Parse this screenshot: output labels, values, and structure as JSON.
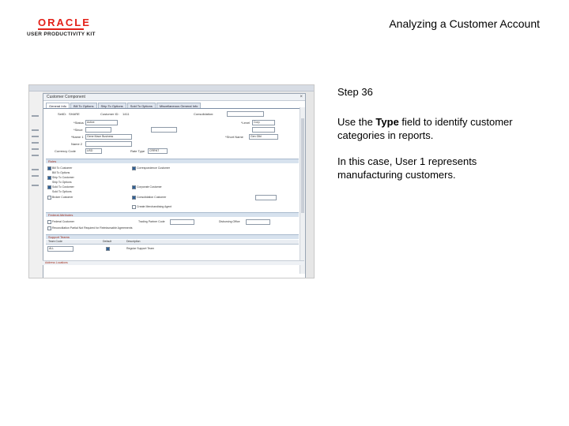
{
  "header": {
    "logo_brand": "ORACLE",
    "logo_sub": "USER PRODUCTIVITY KIT",
    "title": "Analyzing a Customer Account"
  },
  "screenshot": {
    "dialog_title": "Customer Component",
    "tabs": [
      "General Info",
      "Bill To Options",
      "Ship To Options",
      "Sold To Options",
      "Miscellaneous General Info"
    ],
    "fields": {
      "setid_label": "SetID:",
      "setid_value": "SHARE",
      "customer_id_label": "Customer ID:",
      "customer_id_value": "1411",
      "consolidation_label": "Consolidation:",
      "status_label": "*Status",
      "status_value": "Active",
      "since_label": "*Since",
      "level_label": "*Level",
      "level_value": "Corp",
      "name1_label": "*Name 1",
      "name1_value": "Gene Mace Business",
      "name2_label": "Name 2",
      "currency_label": "Currency Code",
      "currency_value": "USD",
      "rate_type_label": "Rate Type",
      "rate_type_value": "CRRNT",
      "short_name_label": "*Short Name",
      "short_name_value": "Gen Glbl"
    },
    "roles_section": "Roles",
    "roles": [
      {
        "label": "Bill To Customer",
        "checked": true
      },
      {
        "label": "Bill To Options",
        "checked": false
      },
      {
        "label": "Ship To Customer",
        "checked": true
      },
      {
        "label": "Ship To Options",
        "checked": false
      },
      {
        "label": "Sold To Customer",
        "checked": true
      },
      {
        "label": "Sold To Options",
        "checked": false
      },
      {
        "label": "Broker Customer",
        "checked": false
      },
      {
        "label": "Correspondence Customer",
        "checked": true
      },
      {
        "label": "Corporate Customer",
        "checked": true
      },
      {
        "label": "Consolidation Customer",
        "checked": true
      },
      {
        "label": "Create Merchandising Agent",
        "checked": false
      }
    ],
    "federal_section": "Federal Attributes",
    "federal_rows": [
      {
        "label": "Federal Customer",
        "checked": false
      },
      {
        "label": "Reconciliation Partial Not Required for Reimbursable Agreements",
        "checked": false
      }
    ],
    "trading_partner_label": "Trading Partner Code",
    "disbursing_label": "Disbursing Office",
    "support_section": "Support Teams",
    "support_header": [
      "Team Code",
      "Default",
      "Description"
    ],
    "support_row": {
      "code": "ALL",
      "description": "Regular Support Team"
    },
    "address_section": "Address Locations"
  },
  "panel": {
    "step": "Step 36",
    "para1_pre": "Use the ",
    "para1_bold": "Type",
    "para1_post": " field to identify customer categories in reports.",
    "para2": "In this case, User 1 represents manufacturing customers."
  }
}
